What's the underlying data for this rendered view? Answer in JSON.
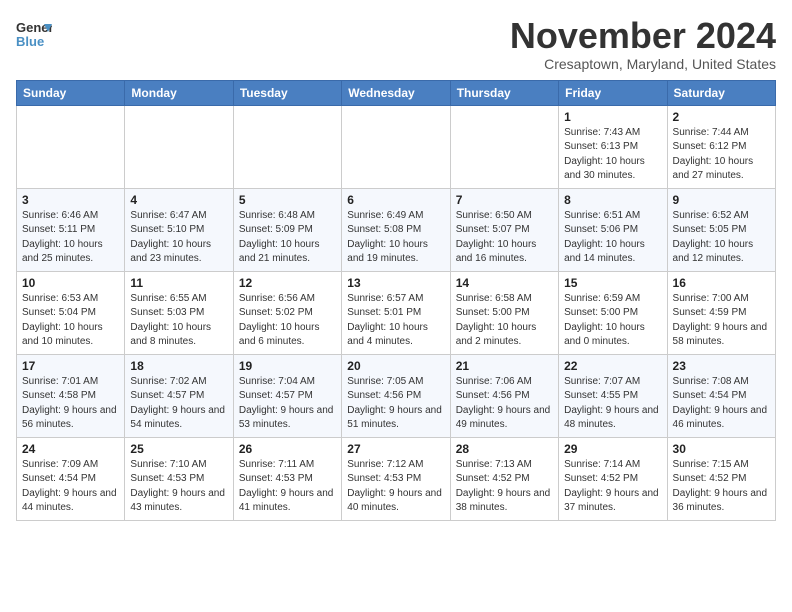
{
  "header": {
    "logo_line1": "General",
    "logo_line2": "Blue",
    "month": "November 2024",
    "location": "Cresaptown, Maryland, United States"
  },
  "days_of_week": [
    "Sunday",
    "Monday",
    "Tuesday",
    "Wednesday",
    "Thursday",
    "Friday",
    "Saturday"
  ],
  "weeks": [
    [
      {
        "day": "",
        "info": ""
      },
      {
        "day": "",
        "info": ""
      },
      {
        "day": "",
        "info": ""
      },
      {
        "day": "",
        "info": ""
      },
      {
        "day": "",
        "info": ""
      },
      {
        "day": "1",
        "info": "Sunrise: 7:43 AM\nSunset: 6:13 PM\nDaylight: 10 hours and 30 minutes."
      },
      {
        "day": "2",
        "info": "Sunrise: 7:44 AM\nSunset: 6:12 PM\nDaylight: 10 hours and 27 minutes."
      }
    ],
    [
      {
        "day": "3",
        "info": "Sunrise: 6:46 AM\nSunset: 5:11 PM\nDaylight: 10 hours and 25 minutes."
      },
      {
        "day": "4",
        "info": "Sunrise: 6:47 AM\nSunset: 5:10 PM\nDaylight: 10 hours and 23 minutes."
      },
      {
        "day": "5",
        "info": "Sunrise: 6:48 AM\nSunset: 5:09 PM\nDaylight: 10 hours and 21 minutes."
      },
      {
        "day": "6",
        "info": "Sunrise: 6:49 AM\nSunset: 5:08 PM\nDaylight: 10 hours and 19 minutes."
      },
      {
        "day": "7",
        "info": "Sunrise: 6:50 AM\nSunset: 5:07 PM\nDaylight: 10 hours and 16 minutes."
      },
      {
        "day": "8",
        "info": "Sunrise: 6:51 AM\nSunset: 5:06 PM\nDaylight: 10 hours and 14 minutes."
      },
      {
        "day": "9",
        "info": "Sunrise: 6:52 AM\nSunset: 5:05 PM\nDaylight: 10 hours and 12 minutes."
      }
    ],
    [
      {
        "day": "10",
        "info": "Sunrise: 6:53 AM\nSunset: 5:04 PM\nDaylight: 10 hours and 10 minutes."
      },
      {
        "day": "11",
        "info": "Sunrise: 6:55 AM\nSunset: 5:03 PM\nDaylight: 10 hours and 8 minutes."
      },
      {
        "day": "12",
        "info": "Sunrise: 6:56 AM\nSunset: 5:02 PM\nDaylight: 10 hours and 6 minutes."
      },
      {
        "day": "13",
        "info": "Sunrise: 6:57 AM\nSunset: 5:01 PM\nDaylight: 10 hours and 4 minutes."
      },
      {
        "day": "14",
        "info": "Sunrise: 6:58 AM\nSunset: 5:00 PM\nDaylight: 10 hours and 2 minutes."
      },
      {
        "day": "15",
        "info": "Sunrise: 6:59 AM\nSunset: 5:00 PM\nDaylight: 10 hours and 0 minutes."
      },
      {
        "day": "16",
        "info": "Sunrise: 7:00 AM\nSunset: 4:59 PM\nDaylight: 9 hours and 58 minutes."
      }
    ],
    [
      {
        "day": "17",
        "info": "Sunrise: 7:01 AM\nSunset: 4:58 PM\nDaylight: 9 hours and 56 minutes."
      },
      {
        "day": "18",
        "info": "Sunrise: 7:02 AM\nSunset: 4:57 PM\nDaylight: 9 hours and 54 minutes."
      },
      {
        "day": "19",
        "info": "Sunrise: 7:04 AM\nSunset: 4:57 PM\nDaylight: 9 hours and 53 minutes."
      },
      {
        "day": "20",
        "info": "Sunrise: 7:05 AM\nSunset: 4:56 PM\nDaylight: 9 hours and 51 minutes."
      },
      {
        "day": "21",
        "info": "Sunrise: 7:06 AM\nSunset: 4:56 PM\nDaylight: 9 hours and 49 minutes."
      },
      {
        "day": "22",
        "info": "Sunrise: 7:07 AM\nSunset: 4:55 PM\nDaylight: 9 hours and 48 minutes."
      },
      {
        "day": "23",
        "info": "Sunrise: 7:08 AM\nSunset: 4:54 PM\nDaylight: 9 hours and 46 minutes."
      }
    ],
    [
      {
        "day": "24",
        "info": "Sunrise: 7:09 AM\nSunset: 4:54 PM\nDaylight: 9 hours and 44 minutes."
      },
      {
        "day": "25",
        "info": "Sunrise: 7:10 AM\nSunset: 4:53 PM\nDaylight: 9 hours and 43 minutes."
      },
      {
        "day": "26",
        "info": "Sunrise: 7:11 AM\nSunset: 4:53 PM\nDaylight: 9 hours and 41 minutes."
      },
      {
        "day": "27",
        "info": "Sunrise: 7:12 AM\nSunset: 4:53 PM\nDaylight: 9 hours and 40 minutes."
      },
      {
        "day": "28",
        "info": "Sunrise: 7:13 AM\nSunset: 4:52 PM\nDaylight: 9 hours and 38 minutes."
      },
      {
        "day": "29",
        "info": "Sunrise: 7:14 AM\nSunset: 4:52 PM\nDaylight: 9 hours and 37 minutes."
      },
      {
        "day": "30",
        "info": "Sunrise: 7:15 AM\nSunset: 4:52 PM\nDaylight: 9 hours and 36 minutes."
      }
    ]
  ]
}
